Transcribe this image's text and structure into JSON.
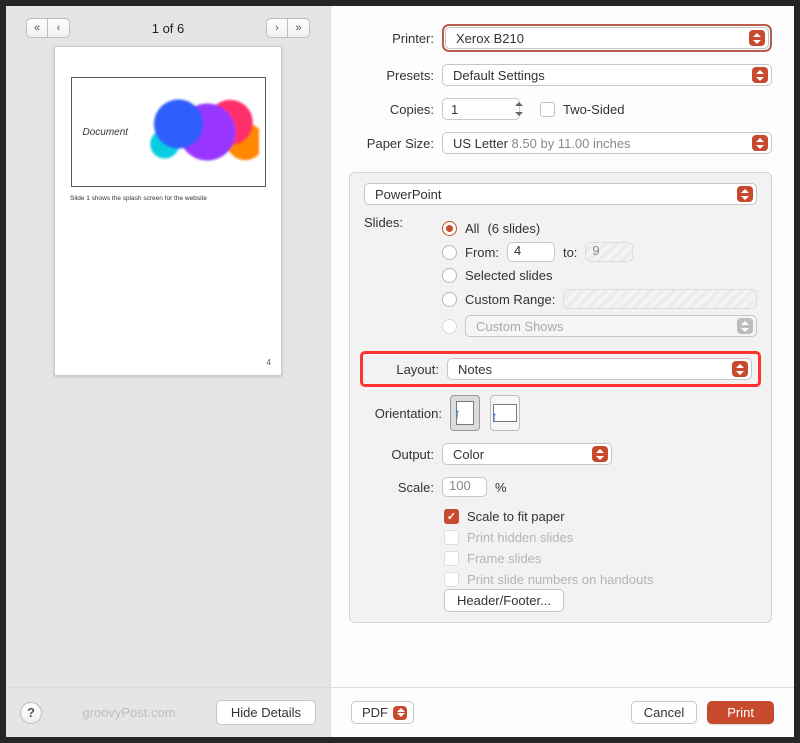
{
  "preview": {
    "counter": "1 of 6",
    "slide_title": "Document",
    "notes_text": "Slide 1 shows the splash screen for the website",
    "page_number": "4"
  },
  "printer": {
    "label": "Printer:",
    "value": "Xerox B210"
  },
  "presets": {
    "label": "Presets:",
    "value": "Default Settings"
  },
  "copies": {
    "label": "Copies:",
    "value": "1",
    "two_sided_label": "Two-Sided"
  },
  "paper": {
    "label": "Paper Size:",
    "value": "US Letter",
    "dims": "8.50 by 11.00 inches"
  },
  "app_select": "PowerPoint",
  "slides": {
    "label": "Slides:",
    "all_label": "All",
    "all_count": "(6 slides)",
    "from_label": "From:",
    "from_val": "4",
    "to_label": "to:",
    "to_val": "9",
    "selected_label": "Selected slides",
    "custom_range_label": "Custom Range:",
    "custom_shows_label": "Custom Shows"
  },
  "layout": {
    "label": "Layout:",
    "value": "Notes"
  },
  "orientation_label": "Orientation:",
  "output": {
    "label": "Output:",
    "value": "Color"
  },
  "scale": {
    "label": "Scale:",
    "value": "100",
    "suffix": "%"
  },
  "opts": {
    "scale_fit": "Scale to fit paper",
    "hidden": "Print hidden slides",
    "frame": "Frame slides",
    "numbers": "Print slide numbers on handouts"
  },
  "header_footer_btn": "Header/Footer...",
  "footer": {
    "brand": "groovyPost.com",
    "hide": "Hide Details",
    "pdf": "PDF",
    "cancel": "Cancel",
    "print": "Print"
  }
}
